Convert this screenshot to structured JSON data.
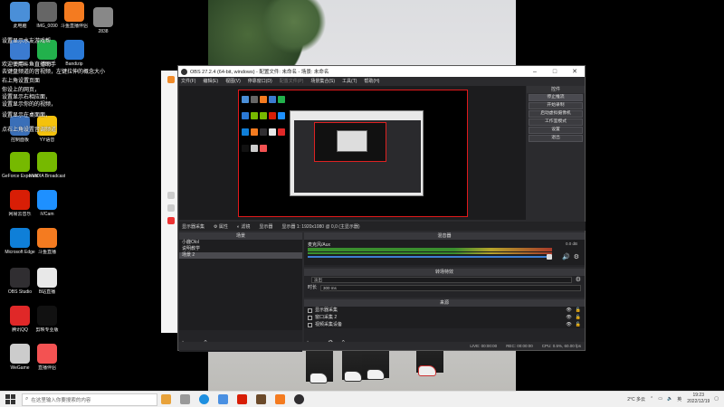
{
  "desktop": {
    "icons": [
      {
        "label": "此电脑",
        "color": "#4a8fd8"
      },
      {
        "label": "IMG_0090",
        "color": "#666"
      },
      {
        "label": "斗鱼直播伴侣",
        "color": "#f47b20"
      },
      {
        "label": "2838",
        "color": "#888"
      },
      {
        "label": "回收站",
        "color": "#3b7bd0"
      },
      {
        "label": "微信",
        "color": "#22b14c"
      },
      {
        "label": "Bandizip",
        "color": "#2a79d6"
      },
      {
        "label": "控制面板",
        "color": "#3a6fb8"
      },
      {
        "label": "YY语音",
        "color": "#f4c20d"
      },
      {
        "label": "GeForce Experience",
        "color": "#76b900"
      },
      {
        "label": "NVIDIA Broadcast",
        "color": "#76b900"
      },
      {
        "label": "网易云音乐",
        "color": "#d81e06"
      },
      {
        "label": "iVCam",
        "color": "#1e90ff"
      },
      {
        "label": "Microsoft Edge",
        "color": "#0f7fd8"
      },
      {
        "label": "斗鱼直播",
        "color": "#f47b20"
      },
      {
        "label": "OBS Studio",
        "color": "#302e31"
      },
      {
        "label": "B站直播",
        "color": "#e8e8e8"
      },
      {
        "label": "腾讯QQ",
        "color": "#e02828"
      },
      {
        "label": "剪映专业版",
        "color": "#111"
      },
      {
        "label": "WeGame",
        "color": "#ccc"
      },
      {
        "label": "直播伴侣",
        "color": "#f35252"
      }
    ],
    "overlay_lines": [
      "设置显示水友游戏帮",
      "欢迎使用斗鱼直播助手",
      "去键盘频道的音视频，左键拉伸的概念大小",
      "右上角设置页面",
      "你设上的网页，",
      "设置显示右相应面，",
      "设置显示你的的视频，",
      "设置显示在桌面面，",
      "点右上角设置音调频道"
    ]
  },
  "obs": {
    "title": "OBS 27.2.4 (64-bit, windows) - 配置文件: 未命名 - 场景: 未命名",
    "menu": [
      {
        "label": "文件(F)",
        "disabled": false
      },
      {
        "label": "编辑(E)",
        "disabled": false
      },
      {
        "label": "视图(V)",
        "disabled": false
      },
      {
        "label": "停靠窗口(D)",
        "disabled": false
      },
      {
        "label": "配置文件(P)",
        "disabled": true
      },
      {
        "label": "场景集合(S)",
        "disabled": false
      },
      {
        "label": "工具(T)",
        "disabled": false
      },
      {
        "label": "帮助(H)",
        "disabled": false
      }
    ],
    "controls": {
      "header": "控件",
      "buttons": [
        "停止推流",
        "开始录制",
        "启动虚拟摄像机",
        "工作室模式",
        "设置",
        "退出"
      ]
    },
    "source_toolbar": {
      "source_name": "显示器采集",
      "properties": "属性",
      "filters": "滤镜",
      "display_label": "显示器",
      "display_value": "显示器 1: 1920x1080 @ 0,0 (主显示器)"
    },
    "scenes": {
      "header": "场景",
      "items": [
        "小鹿Olol",
        "说明教学",
        "场景 2"
      ],
      "selected_index": 2
    },
    "mixer": {
      "header": "混音器",
      "channel": "麦克风/Aux",
      "db": "0.0 dB",
      "level_fraction": 1.0
    },
    "transitions": {
      "header": "转场特效",
      "type": "淡出",
      "duration_label": "时长",
      "duration_value": "300 ms"
    },
    "sources": {
      "header": "来源",
      "items": [
        "显示器采集",
        "窗口采集 2",
        "视频采集设备"
      ]
    },
    "status": {
      "live": "LIVE: 00:00:00",
      "rec": "REC: 00:00:00",
      "cpu": "CPU: 0.5%, 60.00 fps"
    }
  },
  "taskbar": {
    "search_placeholder": "在这里输入你要搜索的内容",
    "weather": "2°C 多云",
    "ime": "英",
    "time": "19:23",
    "date": "2022/12/19"
  }
}
